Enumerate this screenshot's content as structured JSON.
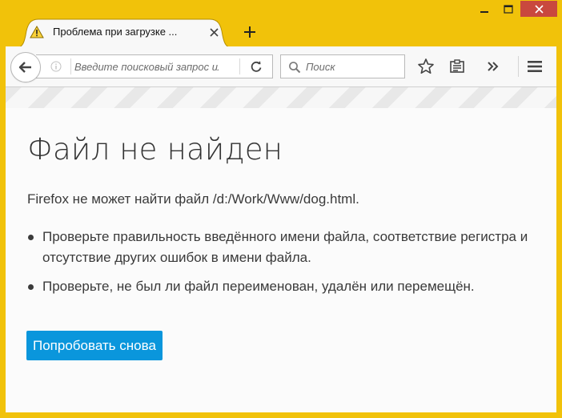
{
  "tab": {
    "title": "Проблема при загрузке ..."
  },
  "toolbar": {
    "url_placeholder": "Введите поисковый запрос или адрес",
    "search_placeholder": "Поиск"
  },
  "error": {
    "title": "Файл не найден",
    "description": "Firefox не может найти файл /d:/Work/Www/dog.html.",
    "suggestions": [
      "Проверьте правильность введённого имени файла, соответствие регистра и отсутствие других ошибок в имени файла.",
      "Проверьте, не был ли файл переименован, удалён или перемещён."
    ],
    "retry_label": "Попробовать снова"
  },
  "colors": {
    "window_frame": "#f1c20a",
    "close_button": "#c9483e",
    "retry_button": "#0a96dc"
  }
}
